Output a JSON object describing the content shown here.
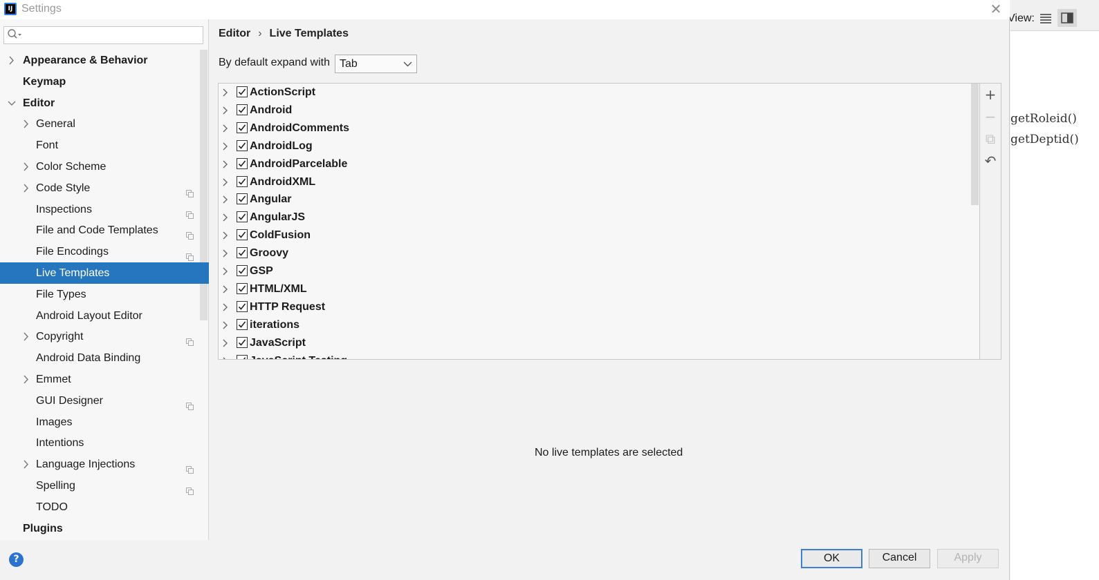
{
  "dialog": {
    "title": "Settings",
    "app_icon_text": "IJ"
  },
  "search": {
    "placeholder": ""
  },
  "sidebar": {
    "items": [
      {
        "label": "Appearance & Behavior",
        "level": 0,
        "bold": true,
        "arrow": "right"
      },
      {
        "label": "Keymap",
        "level": 0,
        "bold": true,
        "arrow": ""
      },
      {
        "label": "Editor",
        "level": 0,
        "bold": true,
        "arrow": "down"
      },
      {
        "label": "General",
        "level": 1,
        "bold": false,
        "arrow": "right"
      },
      {
        "label": "Font",
        "level": 1,
        "bold": false,
        "arrow": ""
      },
      {
        "label": "Color Scheme",
        "level": 1,
        "bold": false,
        "arrow": "right"
      },
      {
        "label": "Code Style",
        "level": 1,
        "bold": false,
        "arrow": "right",
        "project_icon": true
      },
      {
        "label": "Inspections",
        "level": 1,
        "bold": false,
        "arrow": "",
        "project_icon": true
      },
      {
        "label": "File and Code Templates",
        "level": 1,
        "bold": false,
        "arrow": "",
        "project_icon": true
      },
      {
        "label": "File Encodings",
        "level": 1,
        "bold": false,
        "arrow": "",
        "project_icon": true
      },
      {
        "label": "Live Templates",
        "level": 1,
        "bold": false,
        "arrow": "",
        "selected": true
      },
      {
        "label": "File Types",
        "level": 1,
        "bold": false,
        "arrow": ""
      },
      {
        "label": "Android Layout Editor",
        "level": 1,
        "bold": false,
        "arrow": ""
      },
      {
        "label": "Copyright",
        "level": 1,
        "bold": false,
        "arrow": "right",
        "project_icon": true
      },
      {
        "label": "Android Data Binding",
        "level": 1,
        "bold": false,
        "arrow": ""
      },
      {
        "label": "Emmet",
        "level": 1,
        "bold": false,
        "arrow": "right"
      },
      {
        "label": "GUI Designer",
        "level": 1,
        "bold": false,
        "arrow": "",
        "project_icon": true
      },
      {
        "label": "Images",
        "level": 1,
        "bold": false,
        "arrow": ""
      },
      {
        "label": "Intentions",
        "level": 1,
        "bold": false,
        "arrow": ""
      },
      {
        "label": "Language Injections",
        "level": 1,
        "bold": false,
        "arrow": "right",
        "project_icon": true
      },
      {
        "label": "Spelling",
        "level": 1,
        "bold": false,
        "arrow": "",
        "project_icon": true
      },
      {
        "label": "TODO",
        "level": 1,
        "bold": false,
        "arrow": ""
      },
      {
        "label": "Plugins",
        "level": 0,
        "bold": true,
        "arrow": ""
      }
    ]
  },
  "breadcrumb": {
    "parent": "Editor",
    "separator": "›",
    "current": "Live Templates"
  },
  "expand": {
    "label": "By default expand with",
    "selected": "Tab"
  },
  "templates": {
    "groups": [
      {
        "name": "ActionScript",
        "checked": true
      },
      {
        "name": "Android",
        "checked": true
      },
      {
        "name": "AndroidComments",
        "checked": true
      },
      {
        "name": "AndroidLog",
        "checked": true
      },
      {
        "name": "AndroidParcelable",
        "checked": true
      },
      {
        "name": "AndroidXML",
        "checked": true
      },
      {
        "name": "Angular",
        "checked": true
      },
      {
        "name": "AngularJS",
        "checked": true
      },
      {
        "name": "ColdFusion",
        "checked": true
      },
      {
        "name": "Groovy",
        "checked": true
      },
      {
        "name": "GSP",
        "checked": true
      },
      {
        "name": "HTML/XML",
        "checked": true
      },
      {
        "name": "HTTP Request",
        "checked": true
      },
      {
        "name": "iterations",
        "checked": true
      },
      {
        "name": "JavaScript",
        "checked": true
      },
      {
        "name": "JavaScript Testing",
        "checked": true
      }
    ],
    "tools": [
      {
        "name": "add-icon",
        "glyph": "+",
        "enabled": true
      },
      {
        "name": "remove-icon",
        "glyph": "−",
        "enabled": false
      },
      {
        "name": "copy-icon",
        "glyph": "⧉",
        "enabled": false
      },
      {
        "name": "restore-icon",
        "glyph": "↶",
        "enabled": true
      }
    ]
  },
  "detail": {
    "empty_message": "No live templates are selected"
  },
  "buttons": {
    "ok": "OK",
    "cancel": "Cancel",
    "apply": "Apply"
  },
  "help": {
    "glyph": "?"
  },
  "background_ide": {
    "view_label": "View:",
    "code_lines": [
      "getRoleid()",
      "getDeptid()"
    ]
  },
  "colors": {
    "selection": "#2675bf",
    "help": "#2a73cf",
    "ok_border": "#3c7fd6"
  }
}
